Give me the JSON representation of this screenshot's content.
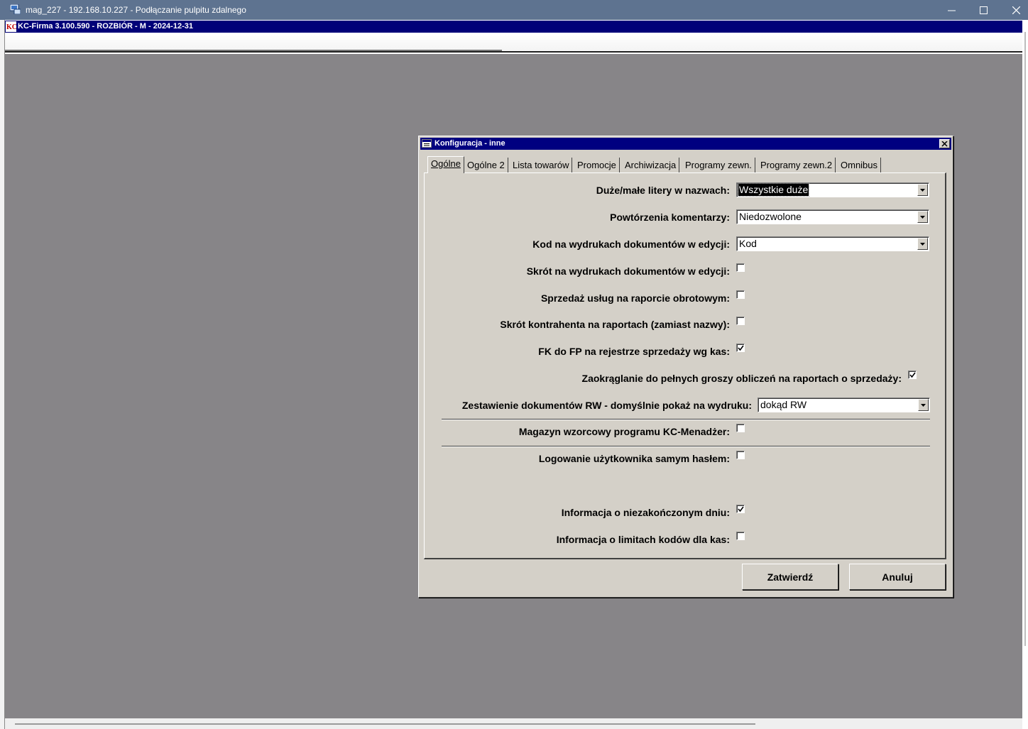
{
  "rdp_window": {
    "title": "mag_227 - 192.168.10.227 - Podłączanie pulpitu zdalnego",
    "icon": "remote-desktop-icon",
    "controls": [
      "minimize-icon",
      "maximize-icon",
      "close-icon"
    ]
  },
  "kc_app": {
    "title": "KC-Firma 3.100.590 - ROZBIÓR - M - 2024-12-31",
    "icon": "kc-logo-icon"
  },
  "dialog": {
    "title": "Konfiguracja - inne",
    "tabs": [
      {
        "label": "Ogólne",
        "active": true
      },
      {
        "label": "Ogólne 2",
        "active": false
      },
      {
        "label": "Lista towarów",
        "active": false
      },
      {
        "label": "Promocje",
        "active": false
      },
      {
        "label": "Archiwizacja",
        "active": false
      },
      {
        "label": "Programy zewn.",
        "active": false
      },
      {
        "label": "Programy zewn.2",
        "active": false
      },
      {
        "label": "Omnibus",
        "active": false
      }
    ],
    "fields": {
      "case_in_names": {
        "label": "Duże/małe litery w nazwach:",
        "value": "Wszystkie duże"
      },
      "comment_repeats": {
        "label": "Powtórzenia komentarzy:",
        "value": "Niedozwolone"
      },
      "code_on_prints": {
        "label": "Kod na wydrukach dokumentów w edycji:",
        "value": "Kod"
      },
      "shortcut_on_prints": {
        "label": "Skrót na wydrukach dokumentów w edycji:",
        "checked": false
      },
      "service_sales_report": {
        "label": "Sprzedaż usług na raporcie obrotowym:",
        "checked": false
      },
      "contractor_shortcut": {
        "label": "Skrót kontrahenta na raportach (zamiast nazwy):",
        "checked": false
      },
      "fk_to_fp": {
        "label": "FK do FP na rejestrze sprzedaży wg kas:",
        "checked": true
      },
      "rounding": {
        "label": "Zaokrąglanie do pełnych groszy obliczeń na raportach o sprzedaży:",
        "checked": true
      },
      "rw_summary": {
        "label": "Zestawienie dokumentów RW - domyślnie pokaż na wydruku:",
        "value": "dokąd RW"
      },
      "template_warehouse": {
        "label": "Magazyn wzorcowy programu KC-Menadżer:",
        "checked": false
      },
      "password_login": {
        "label": "Logowanie użytkownika samym hasłem:",
        "checked": false
      },
      "unfinished_day": {
        "label": "Informacja o niezakończonym dniu:",
        "checked": true
      },
      "code_limits": {
        "label": "Informacja o limitach kodów dla kas:",
        "checked": false
      }
    },
    "buttons": {
      "confirm": "Zatwierdź",
      "cancel": "Anuluj"
    }
  }
}
